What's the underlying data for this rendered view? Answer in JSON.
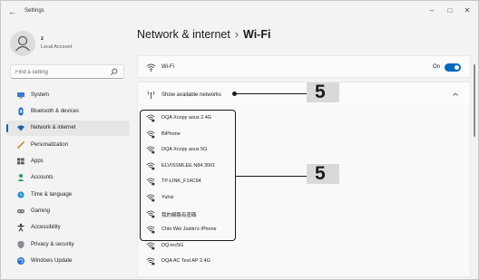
{
  "window": {
    "title": "Settings"
  },
  "user": {
    "name": "z",
    "account_type": "Local Account"
  },
  "search": {
    "placeholder": "Find a setting"
  },
  "sidebar": {
    "items": [
      {
        "label": "System",
        "icon": "monitor-icon",
        "selected": false
      },
      {
        "label": "Bluetooth & devices",
        "icon": "bluetooth-icon",
        "selected": false
      },
      {
        "label": "Network & internet",
        "icon": "wifi-icon",
        "selected": true
      },
      {
        "label": "Personalization",
        "icon": "brush-icon",
        "selected": false
      },
      {
        "label": "Apps",
        "icon": "apps-icon",
        "selected": false
      },
      {
        "label": "Accounts",
        "icon": "person-icon",
        "selected": false
      },
      {
        "label": "Time & language",
        "icon": "globe-clock-icon",
        "selected": false
      },
      {
        "label": "Gaming",
        "icon": "gamepad-icon",
        "selected": false
      },
      {
        "label": "Accessibility",
        "icon": "accessibility-icon",
        "selected": false
      },
      {
        "label": "Privacy & security",
        "icon": "shield-icon",
        "selected": false
      },
      {
        "label": "Windows Update",
        "icon": "update-icon",
        "selected": false
      }
    ]
  },
  "breadcrumb": {
    "parent": "Network & internet",
    "separator": "›",
    "current": "Wi-Fi"
  },
  "wifi": {
    "label": "Wi-Fi",
    "state": "On",
    "enabled": true
  },
  "show_networks": {
    "label": "Show available networks",
    "expanded": true
  },
  "networks": [
    "DQA Xcopy asus 2.4G",
    "BiPhone",
    "DQA Xcopy asus 5G",
    "ELVISSMLEE N84 3001",
    "TP-LINK_F14C94",
    "Yuhsi",
    "我的網路有密碼",
    "Chin Wei Justin's iPhone",
    "DQ-inc5G",
    "DQA AC Test AP 2.4G"
  ],
  "callouts": {
    "show_networks": "5",
    "network_list": "5"
  },
  "colors": {
    "accent": "#0067c0",
    "callout_bg": "#d9d9d9"
  }
}
